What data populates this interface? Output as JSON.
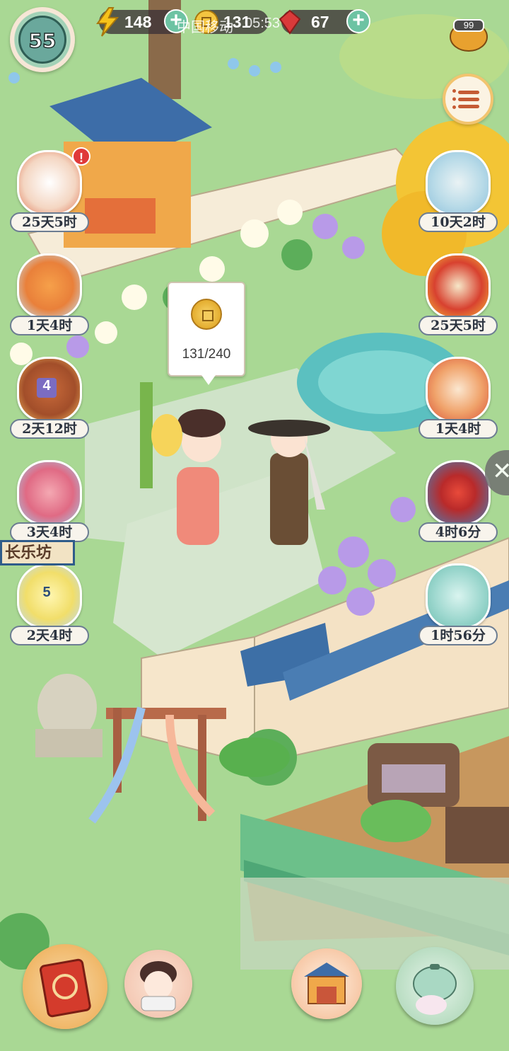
{
  "status_bar": {
    "carrier": "中国移动",
    "time": "05:53",
    "battery": "99"
  },
  "player": {
    "level": "55"
  },
  "resources": [
    {
      "name": "energy",
      "icon": "lightning-icon",
      "value": "148"
    },
    {
      "name": "coins",
      "icon": "coin-icon",
      "value": "131"
    },
    {
      "name": "gems",
      "icon": "ruby-icon",
      "value": "67"
    }
  ],
  "events_left": [
    {
      "icon": "letter-flowers-icon",
      "timer": "25天5时",
      "alert": "!"
    },
    {
      "icon": "fox-icon",
      "timer": "1天4时"
    },
    {
      "icon": "treasure-chest-icon",
      "timer": "2天12时",
      "badge": "4"
    },
    {
      "icon": "pink-wheel-icon",
      "timer": "3天4时"
    },
    {
      "icon": "jar-icon",
      "timer": "2天4时",
      "badge": "5"
    }
  ],
  "events_right": [
    {
      "icon": "cat-clouds-icon",
      "timer": "10天2时"
    },
    {
      "icon": "coins-scroll-icon",
      "timer": "25天5时"
    },
    {
      "icon": "lucky-cat-icon",
      "timer": "1天4时"
    },
    {
      "icon": "red-fan-icon",
      "timer": "4时6分"
    },
    {
      "icon": "gift-box-cat-icon",
      "timer": "1时56分"
    }
  ],
  "coin_bubble": {
    "progress": "131/240"
  },
  "sign_text": "长乐坊",
  "bottom_nav": [
    {
      "icon": "red-book-icon"
    },
    {
      "icon": "lady-portrait-icon"
    },
    {
      "icon": "shop-stall-icon"
    },
    {
      "icon": "teapot-rabbit-icon"
    }
  ]
}
